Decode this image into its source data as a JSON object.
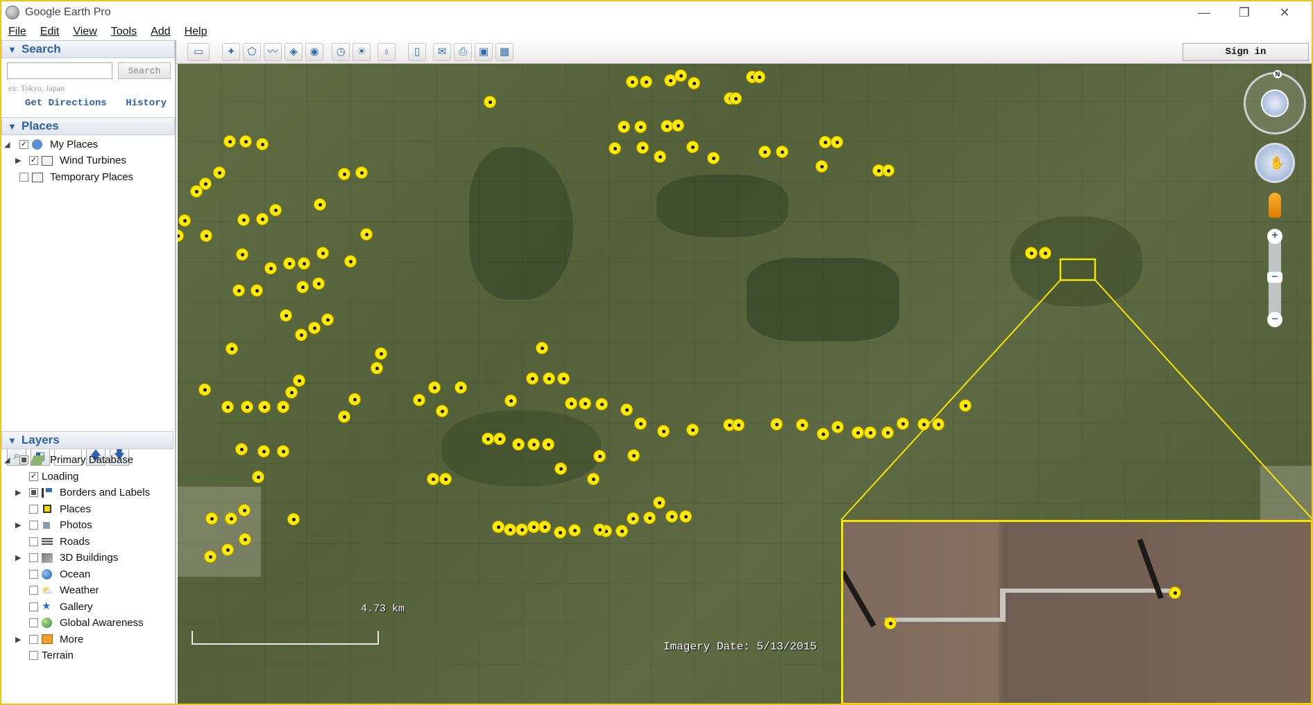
{
  "window": {
    "title": "Google Earth Pro",
    "minimize_glyph": "—",
    "restore_glyph": "❐",
    "close_glyph": "✕"
  },
  "menu": {
    "items": [
      "File",
      "Edit",
      "View",
      "Tools",
      "Add",
      "Help"
    ]
  },
  "search": {
    "header": "Search",
    "input_value": "",
    "button_label": "Search",
    "hint": "ex: Tokyo, Japan",
    "directions_link": "Get Directions",
    "history_link": "History"
  },
  "places": {
    "header": "Places",
    "items": [
      {
        "label": "My Places",
        "checked": true,
        "icon": "my-places-icon"
      },
      {
        "label": "Wind Turbines",
        "checked": true,
        "icon": "folder-icon"
      },
      {
        "label": "Temporary Places",
        "checked": false,
        "icon": "folder-icon"
      }
    ]
  },
  "layers": {
    "header": "Layers",
    "items": [
      {
        "label": "Primary Database",
        "state": "partial",
        "icon": "database-icon"
      },
      {
        "label": "Loading",
        "state": "checked",
        "icon": ""
      },
      {
        "label": "Borders and Labels",
        "state": "partial",
        "icon": "borders-icon"
      },
      {
        "label": "Places",
        "state": "unchecked",
        "icon": "places-icon"
      },
      {
        "label": "Photos",
        "state": "unchecked",
        "icon": "photos-icon"
      },
      {
        "label": "Roads",
        "state": "unchecked",
        "icon": "roads-icon"
      },
      {
        "label": "3D Buildings",
        "state": "unchecked",
        "icon": "buildings-icon"
      },
      {
        "label": "Ocean",
        "state": "unchecked",
        "icon": "ocean-icon"
      },
      {
        "label": "Weather",
        "state": "unchecked",
        "icon": "weather-icon"
      },
      {
        "label": "Gallery",
        "state": "unchecked",
        "icon": "gallery-icon"
      },
      {
        "label": "Global Awareness",
        "state": "unchecked",
        "icon": "global-awareness-icon"
      },
      {
        "label": "More",
        "state": "unchecked",
        "icon": "more-icon"
      },
      {
        "label": "Terrain",
        "state": "unchecked",
        "icon": ""
      }
    ]
  },
  "toolbar": {
    "sign_in_label": "Sign in"
  },
  "map": {
    "scale_label": "4.73 km",
    "imagery_date": "Imagery Date: 5/13/2015",
    "compass_label": "N"
  },
  "colors": {
    "accent": "#2d5fa8",
    "marker": "#ffea00",
    "highlight": "#f3e600"
  }
}
